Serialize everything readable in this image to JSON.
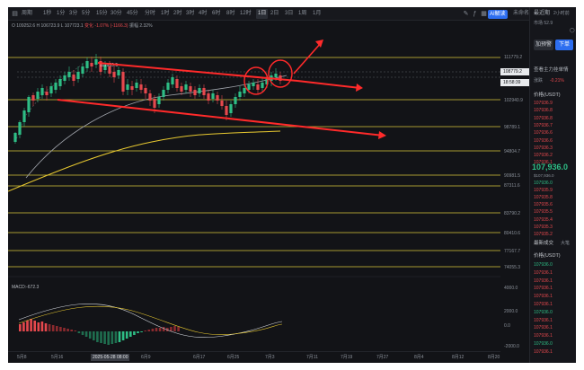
{
  "toolbar": {
    "main_icon": "chart-type-icon",
    "period_label": "周期",
    "timeframes": [
      "1秒",
      "1分",
      "3分",
      "5分",
      "15分",
      "30分",
      "45分",
      "分时",
      "1时",
      "2时",
      "3时",
      "4时",
      "6时",
      "8时",
      "12时",
      "1日",
      "2日",
      "3日",
      "1周",
      "1月"
    ],
    "selected_timeframe": "1日",
    "ai_label": "AI解读",
    "settings_label": "未命名"
  },
  "ohlc": {
    "open": "O 109252.6",
    "high": "H 106723.9",
    "low": "L 107723.1",
    "change": "变化 -1.07% (-1166.3)",
    "amp": "振幅 2.32%"
  },
  "chart": {
    "high_label": "111959.5",
    "price_tag_top": "108779.2",
    "price_tag_bottom": "18:58:39",
    "price_levels": [
      "111779.2",
      "102940.9",
      "98789.1",
      "94804.7",
      "90981.5",
      "87311.6",
      "83790.2",
      "80410.6",
      "77167.7",
      "74055.3"
    ],
    "macd_label": "MACD:-672.3",
    "macd_levels": [
      "4000.0",
      "2000.0",
      "0.0",
      "-2000.0"
    ],
    "date_labels": [
      "5月8",
      "5月16",
      "5月28",
      "6月9",
      "6月17",
      "6月25",
      "7月3",
      "7月11",
      "7月19",
      "7月27",
      "8月4",
      "8月12",
      "8月20"
    ],
    "crosshair_date": "2025-05-28 08:00",
    "colors": {
      "up": "#2ebd85",
      "down": "#e5484d",
      "level_line": "#d9c63a",
      "annotation": "#ff2a2a",
      "ma_yellow": "#e8c930",
      "ma_gray": "#a0a4ab"
    }
  },
  "sidebar": {
    "title": "最近期",
    "time_label": "2小时前",
    "status_text": "市场 52.9",
    "add_button": "加预警",
    "order_button": "下单",
    "depth_title": "查看主力挂单情",
    "change_label": "涨跌",
    "change_value": "-0.21%",
    "price_header": "价格(USDT)",
    "asks": [
      "107936.9",
      "107936.8",
      "107936.8",
      "107936.7",
      "107936.6",
      "107936.6",
      "107936.3",
      "107936.2",
      "107936.1"
    ],
    "current_price": "107,936.0",
    "current_price_sub": "$107,936.0",
    "bids": [
      "107936.0",
      "107935.9",
      "107935.8",
      "107935.6",
      "107935.5",
      "107935.4",
      "107935.3",
      "107935.2"
    ],
    "trades_title": "最新成交",
    "trades_tab2": "大笔",
    "trades_price_header": "价格(USDT)",
    "trades": [
      {
        "p": "107936.0",
        "s": "g"
      },
      {
        "p": "107936.1",
        "s": "r"
      },
      {
        "p": "107936.1",
        "s": "r"
      },
      {
        "p": "107936.1",
        "s": "r"
      },
      {
        "p": "107936.1",
        "s": "r"
      },
      {
        "p": "107936.1",
        "s": "r"
      },
      {
        "p": "107936.0",
        "s": "g"
      },
      {
        "p": "107936.1",
        "s": "r"
      },
      {
        "p": "107936.1",
        "s": "r"
      },
      {
        "p": "107936.1",
        "s": "r"
      },
      {
        "p": "107936.0",
        "s": "g"
      },
      {
        "p": "107936.1",
        "s": "r"
      }
    ]
  }
}
